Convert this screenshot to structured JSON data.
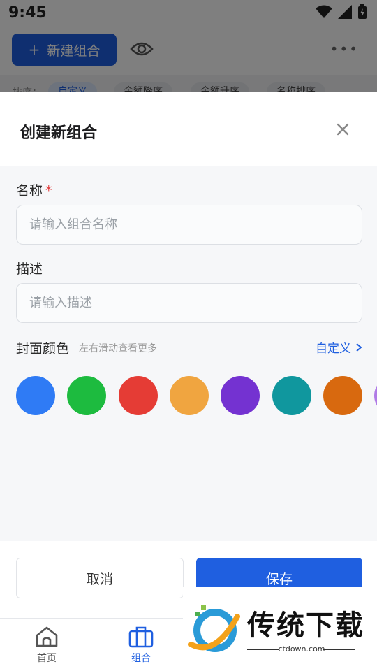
{
  "status": {
    "time": "9:45"
  },
  "toolbar": {
    "new_group_label": "新建组合",
    "plus": "+"
  },
  "sort": {
    "label": "排序：",
    "chips": [
      {
        "label": "自定义",
        "active": true
      },
      {
        "label": "金额降序",
        "active": false
      },
      {
        "label": "金额升序",
        "active": false
      },
      {
        "label": "名称排序",
        "active": false
      }
    ]
  },
  "dialog": {
    "title": "创建新组合",
    "name_label": "名称",
    "required_mark": "*",
    "name_placeholder": "请输入组合名称",
    "name_value": "",
    "desc_label": "描述",
    "desc_placeholder": "请输入描述",
    "desc_value": "",
    "cover_label": "封面颜色",
    "cover_hint": "左右滑动查看更多",
    "custom_label": "自定义",
    "colors": [
      "#2f7bf5",
      "#1dbb3f",
      "#e53c35",
      "#f0a540",
      "#7432d1",
      "#10979e",
      "#d8690f",
      "#b07be6"
    ],
    "cancel_label": "取消",
    "save_label": "保存"
  },
  "nav": {
    "home_label": "首页",
    "group_label": "组合"
  },
  "watermark": {
    "text": "传统下载",
    "url": "ctdown.com"
  }
}
